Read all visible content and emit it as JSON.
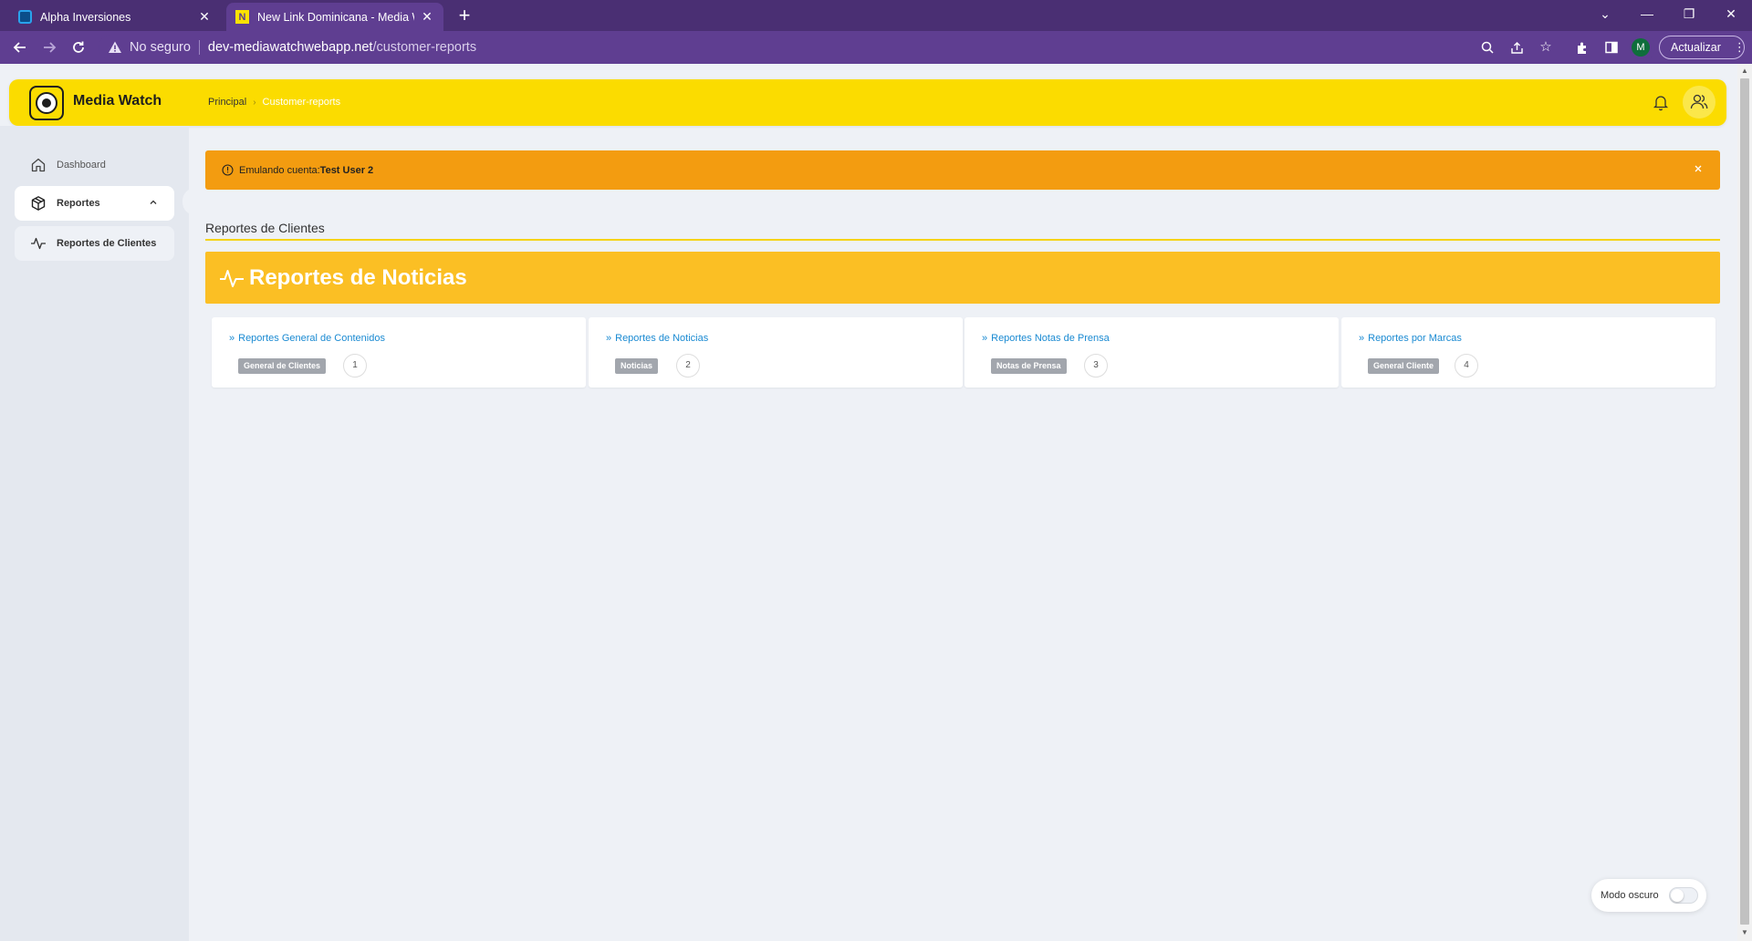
{
  "browser": {
    "tabs": [
      {
        "title": "Alpha Inversiones",
        "favicon": "alpha-favicon",
        "active": false
      },
      {
        "title": "New Link Dominicana - Media W",
        "favicon": "newlink-favicon",
        "active": true
      }
    ],
    "new_tab_symbol": "+",
    "security_label": "No seguro",
    "url_host": "dev-mediawatchwebapp.net",
    "url_path": "/customer-reports",
    "profile_initial": "M",
    "update_label": "Actualizar"
  },
  "header": {
    "app_name": "Media Watch",
    "breadcrumb": {
      "home": "Principal",
      "current": "Customer-reports"
    }
  },
  "sidebar": {
    "items": [
      {
        "label": "Dashboard",
        "icon": "home-icon"
      },
      {
        "label": "Reportes",
        "icon": "box-icon",
        "expanded": true
      },
      {
        "label": "Reportes de Clientes",
        "icon": "activity-icon"
      }
    ]
  },
  "alert": {
    "prefix": "Emulando cuenta:",
    "account": "Test User 2",
    "color": "#f39c10"
  },
  "main": {
    "section_title": "Reportes de Clientes",
    "banner_title": "Reportes de Noticias",
    "banner_color": "#fbbf24",
    "cards": [
      {
        "title": "Reportes General de Contenidos",
        "tag": "General de Clientes",
        "count": "1"
      },
      {
        "title": "Reportes de Noticias",
        "tag": "Noticias",
        "count": "2"
      },
      {
        "title": "Reportes Notas de Prensa",
        "tag": "Notas de Prensa",
        "count": "3"
      },
      {
        "title": "Reportes por Marcas",
        "tag": "General Cliente",
        "count": "4"
      }
    ]
  },
  "dark_mode": {
    "label": "Modo oscuro",
    "enabled": false
  },
  "colors": {
    "brand_yellow": "#fbdc00",
    "link_blue": "#1a8ad2",
    "chrome_purple": "#5f3e91"
  }
}
